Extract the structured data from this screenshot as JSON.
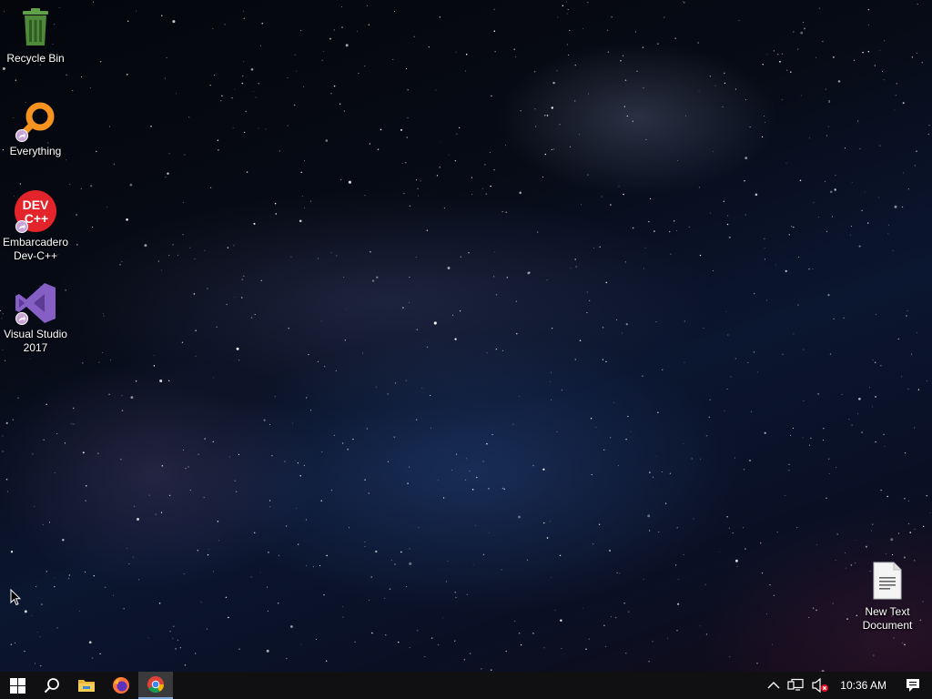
{
  "desktop": {
    "icons": [
      {
        "label": "Recycle Bin",
        "icon": "recycle-bin-icon"
      },
      {
        "label": "Everything",
        "icon": "everything-search-icon"
      },
      {
        "label": "Embarcadero\nDev-C++",
        "icon": "dev-cpp-icon",
        "badge": "DEV\nC++"
      },
      {
        "label": "Visual Studio\n2017",
        "icon": "visual-studio-icon"
      },
      {
        "label": "New Text\nDocument",
        "icon": "text-document-icon"
      }
    ]
  },
  "taskbar": {
    "pinned": [
      {
        "icon": "windows-start-icon"
      },
      {
        "icon": "search-icon"
      },
      {
        "icon": "file-explorer-icon"
      },
      {
        "icon": "firefox-icon"
      },
      {
        "icon": "chrome-icon",
        "active": true
      }
    ],
    "tray": {
      "icons": [
        "chevron-up-icon",
        "network-icon",
        "volume-muted-icon"
      ],
      "clock": "10:36 AM",
      "notification_icon": "action-center-icon"
    }
  },
  "colors": {
    "taskbar_bg": "#101012",
    "active_underline": "#7aa7d8",
    "vs_purple": "#865fc5",
    "devcpp_red": "#e3242b",
    "everything_orange": "#f7931e",
    "recycle_green": "#4e8a3a"
  }
}
